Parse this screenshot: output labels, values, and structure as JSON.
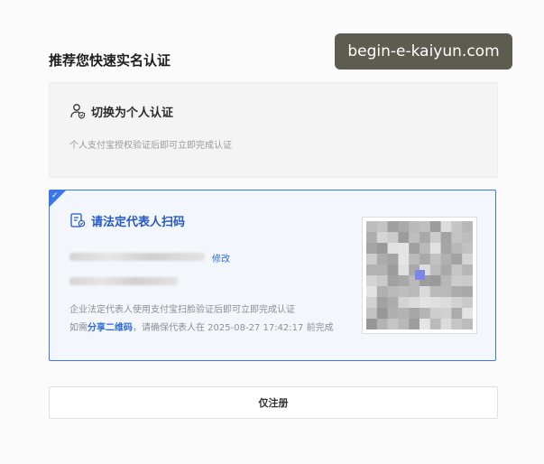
{
  "page": {
    "title": "推荐您快速实名认证",
    "watermark": "begin-e-kaiyun.com"
  },
  "personal_card": {
    "title": "切换为个人认证",
    "description": "个人支付宝授权验证后即可立即完成认证",
    "icon": "user-shield-icon"
  },
  "legal_card": {
    "title": "请法定代表人扫码",
    "icon": "id-card-icon",
    "selected": true,
    "edit_label": "修改",
    "description": "企业法定代表人使用支付宝扫脸验证后即可立即完成认证",
    "share_prefix": "如需",
    "share_link": "分享二维码",
    "share_suffix": "，请确保代表人在 2025-08-27 17:42:17 前完成",
    "accent_color": "#3b78e7"
  },
  "register_button": {
    "label": "仅注册"
  }
}
